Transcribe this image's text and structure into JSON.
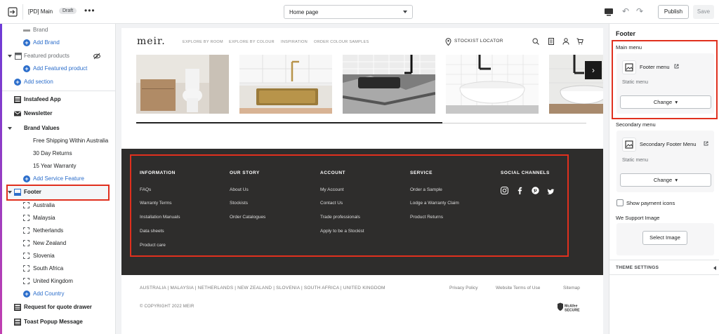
{
  "topbar": {
    "theme_name": "[PD] Main",
    "status_badge": "Draft",
    "more_label": "•••",
    "page_select": "Home page",
    "publish_label": "Publish",
    "save_label": "Save"
  },
  "sidebar": {
    "brand": "Brand",
    "add_brand": "Add Brand",
    "featured_products": "Featured products",
    "add_featured_product": "Add Featured product",
    "add_section": "Add section",
    "instafeed": "Instafeed App",
    "newsletter": "Newsletter",
    "brand_values": "Brand Values",
    "bv_items": [
      "Free Shipping Within Australia",
      "30 Day Returns",
      "15 Year Warranty"
    ],
    "add_service_feature": "Add Service Feature",
    "footer": "Footer",
    "countries": [
      "Australia",
      "Malaysia",
      "Netherlands",
      "New Zealand",
      "Slovenia",
      "South Africa",
      "United Kingdom"
    ],
    "add_country": "Add Country",
    "request_quote": "Request for quote drawer",
    "toast_popup": "Toast Popup Message"
  },
  "preview": {
    "logo": "meir.",
    "nav": [
      "EXPLORE BY ROOM",
      "EXPLORE BY COLOUR",
      "INSPIRATION",
      "ORDER COLOUR SAMPLES"
    ],
    "stockist": "STOCKIST LOCATOR",
    "carousel_progress": 0.68,
    "footer_columns": [
      {
        "heading": "INFORMATION",
        "links": [
          "FAQs",
          "Warranty Terms",
          "Installation Manuals",
          "Data sheets",
          "Product care"
        ]
      },
      {
        "heading": "OUR STORY",
        "links": [
          "About Us",
          "Stockists",
          "Order Catalogues"
        ]
      },
      {
        "heading": "ACCOUNT",
        "links": [
          "My Account",
          "Contact Us",
          "Trade professionals",
          "Apply to be a Stockist"
        ]
      },
      {
        "heading": "SERVICE",
        "links": [
          "Order a Sample",
          "Lodge a Warranty Claim",
          "Product Returns"
        ]
      },
      {
        "heading": "SOCIAL CHANNELS",
        "links": []
      }
    ],
    "countries_line": "AUSTRALIA |  MALAYSIA |  NETHERLANDS |  NEW ZEALAND |  SLOVENIA |  SOUTH AFRICA |  UNITED KINGDOM",
    "legal": [
      "Privacy Policy",
      "Website Terms of Use",
      "Sitemap"
    ],
    "copyright": "© COPYRIGHT 2022 MEIR",
    "mcafee_line1": "McAfee",
    "mcafee_line2": "SECURE"
  },
  "rpanel": {
    "title": "Footer",
    "main_menu_label": "Main menu",
    "main_menu_name": "Footer menu",
    "main_menu_sub": "Static menu",
    "change_label": "Change",
    "secondary_menu_label": "Secondary menu",
    "secondary_menu_name": "Secondary Footer Menu",
    "secondary_menu_sub": "Static menu",
    "show_payment_icons": "Show payment icons",
    "we_support_label": "We Support Image",
    "select_image": "Select Image",
    "theme_settings": "THEME SETTINGS"
  },
  "colors": {
    "accent_blue": "#2c6ecb",
    "highlight_red": "#e0301e",
    "footer_dark": "#2e2d2c"
  }
}
